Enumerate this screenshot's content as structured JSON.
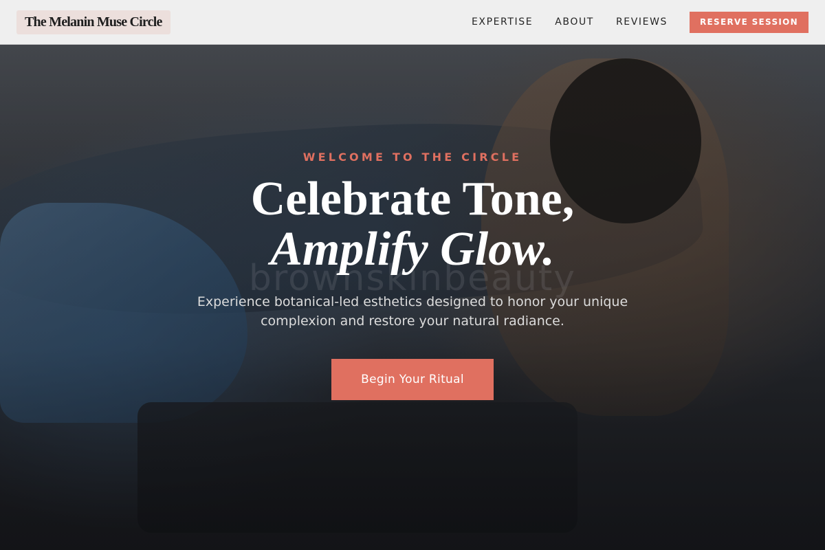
{
  "header": {
    "logo": "The Melanin Muse Circle",
    "nav": [
      {
        "label": "EXPERTISE"
      },
      {
        "label": "ABOUT"
      },
      {
        "label": "REVIEWS"
      }
    ],
    "cta_label": "RESERVE SESSION"
  },
  "hero": {
    "eyebrow": "WELCOME TO THE CIRCLE",
    "headline_line1": "Celebrate Tone,",
    "headline_line2": "Amplify Glow.",
    "subtext": "Experience botanical-led esthetics designed to honor your unique complexion and restore your natural radiance.",
    "cta_label": "Begin Your Ritual",
    "watermark": "brownskinbeauty"
  },
  "colors": {
    "accent": "#e07060",
    "nav_background": "#efefef",
    "logo_background": "#ecdfdc"
  }
}
